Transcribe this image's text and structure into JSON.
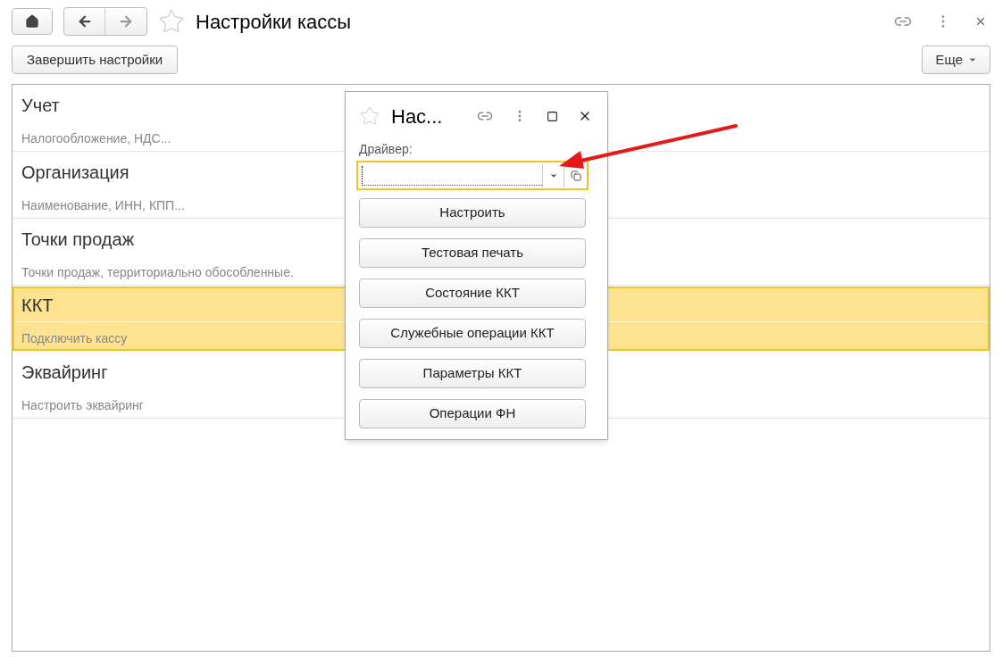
{
  "window": {
    "title": "Настройки кассы"
  },
  "toolbar": {
    "finish_button": "Завершить настройки",
    "more_button": "Еще"
  },
  "sections": [
    {
      "title": "Учет",
      "subtitle": "Налогообложение, НДС...",
      "selected": false
    },
    {
      "title": "Организация",
      "subtitle": "Наименование, ИНН, КПП...",
      "selected": false
    },
    {
      "title": "Точки продаж",
      "subtitle": "Точки продаж, территориально обособленные.",
      "selected": false
    },
    {
      "title": "ККТ",
      "subtitle": "Подключить кассу",
      "selected": true
    },
    {
      "title": "Эквайринг",
      "subtitle": "Настроить эквайринг",
      "selected": false
    }
  ],
  "dialog": {
    "title": "Нас...",
    "driver_label": "Драйвер:",
    "buttons": [
      "Настроить",
      "Тестовая печать",
      "Состояние ККТ",
      "Служебные операции ККТ",
      "Параметры ККТ",
      "Операции ФН"
    ]
  }
}
